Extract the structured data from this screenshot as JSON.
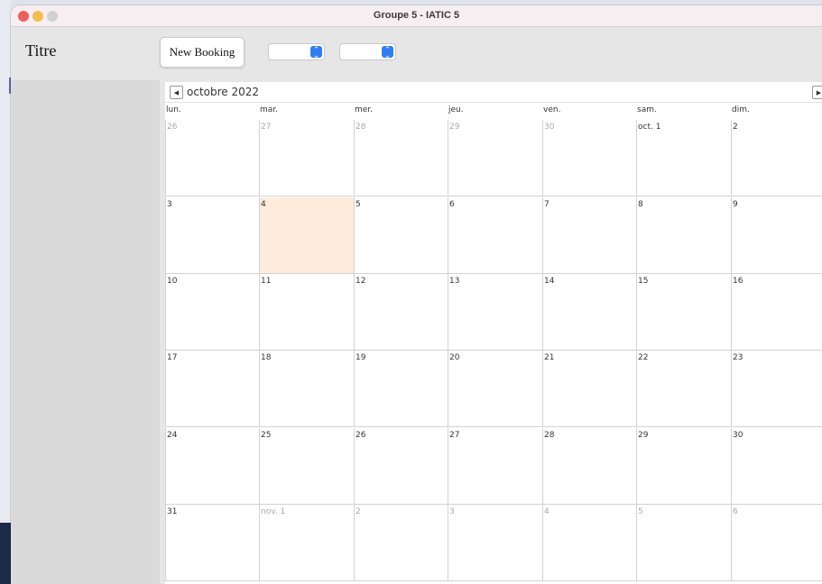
{
  "window": {
    "title": "Groupe 5 - IATIC 5"
  },
  "toolbar": {
    "titre": "Titre",
    "new_booking": "New Booking"
  },
  "calendar": {
    "month_label": "octobre 2022",
    "days_of_week": [
      "lun.",
      "mar.",
      "mer.",
      "jeu.",
      "ven.",
      "sam.",
      "dim."
    ],
    "weeks": [
      [
        {
          "label": "26",
          "current": false
        },
        {
          "label": "27",
          "current": false
        },
        {
          "label": "28",
          "current": false
        },
        {
          "label": "29",
          "current": false
        },
        {
          "label": "30",
          "current": false
        },
        {
          "label": "oct. 1",
          "current": true
        },
        {
          "label": "2",
          "current": true
        }
      ],
      [
        {
          "label": "3",
          "current": true
        },
        {
          "label": "4",
          "current": true,
          "today": true
        },
        {
          "label": "5",
          "current": true
        },
        {
          "label": "6",
          "current": true
        },
        {
          "label": "7",
          "current": true
        },
        {
          "label": "8",
          "current": true
        },
        {
          "label": "9",
          "current": true
        }
      ],
      [
        {
          "label": "10",
          "current": true
        },
        {
          "label": "11",
          "current": true
        },
        {
          "label": "12",
          "current": true
        },
        {
          "label": "13",
          "current": true
        },
        {
          "label": "14",
          "current": true
        },
        {
          "label": "15",
          "current": true
        },
        {
          "label": "16",
          "current": true
        }
      ],
      [
        {
          "label": "17",
          "current": true
        },
        {
          "label": "18",
          "current": true
        },
        {
          "label": "19",
          "current": true
        },
        {
          "label": "20",
          "current": true
        },
        {
          "label": "21",
          "current": true
        },
        {
          "label": "22",
          "current": true
        },
        {
          "label": "23",
          "current": true
        }
      ],
      [
        {
          "label": "24",
          "current": true
        },
        {
          "label": "25",
          "current": true
        },
        {
          "label": "26",
          "current": true
        },
        {
          "label": "27",
          "current": true
        },
        {
          "label": "28",
          "current": true
        },
        {
          "label": "29",
          "current": true
        },
        {
          "label": "30",
          "current": true
        }
      ],
      [
        {
          "label": "31",
          "current": true
        },
        {
          "label": "nov. 1",
          "current": false
        },
        {
          "label": "2",
          "current": false
        },
        {
          "label": "3",
          "current": false
        },
        {
          "label": "4",
          "current": false
        },
        {
          "label": "5",
          "current": false
        },
        {
          "label": "6",
          "current": false
        }
      ]
    ],
    "colors": {
      "today_bg": "#fdebdc",
      "other_month_text": "#a9a9a9"
    }
  },
  "icons": {
    "prev": "prev-month-icon",
    "next": "next-month-icon",
    "prev_glyph": "◀",
    "next_glyph": "▶",
    "select_arrows": "chevron-up-down-icon"
  },
  "window_controls": [
    "close",
    "minimize",
    "zoom"
  ]
}
